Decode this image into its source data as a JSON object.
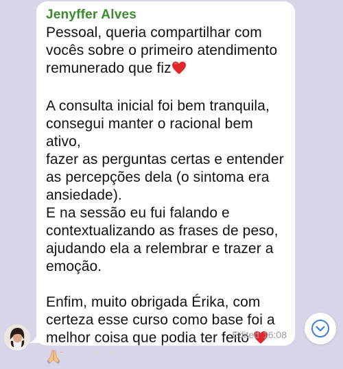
{
  "message": {
    "sender": "Jenyffer Alves",
    "paragraphs": [
      [
        "Pessoal, queria compartilhar com",
        "vocês sobre o primeiro atendimento",
        "remunerado que fiz"
      ],
      [
        "A consulta inicial foi bem tranquila,",
        "consegui manter o racional bem ativo,",
        "fazer as perguntas certas e entender",
        "as percepções dela (o sintoma era",
        "ansiedade).",
        "E na sessão eu fui falando e",
        "contextualizando as frases de peso,",
        "ajudando ela a relembrar e trazer a",
        "emoção."
      ],
      [
        "Enfim, muito obrigada Érika, com",
        "certeza esse curso como base foi a",
        "melhor coisa que podia ter feito"
      ]
    ],
    "emojis": [
      "red-heart",
      "red-heart",
      "folded-hands"
    ],
    "edited_label": "Edited",
    "time": "16:08"
  },
  "colors": {
    "background": "#d9d5e8",
    "bubble": "#ffffff",
    "sender_name": "#3a8a2e",
    "meta_text": "#9a9aa2",
    "scroll_button_icon": "#3d7fd6",
    "heart": "#e0262b"
  },
  "icons": {
    "scroll_down": "chevron-down-circle-icon",
    "avatar": "user-avatar"
  }
}
